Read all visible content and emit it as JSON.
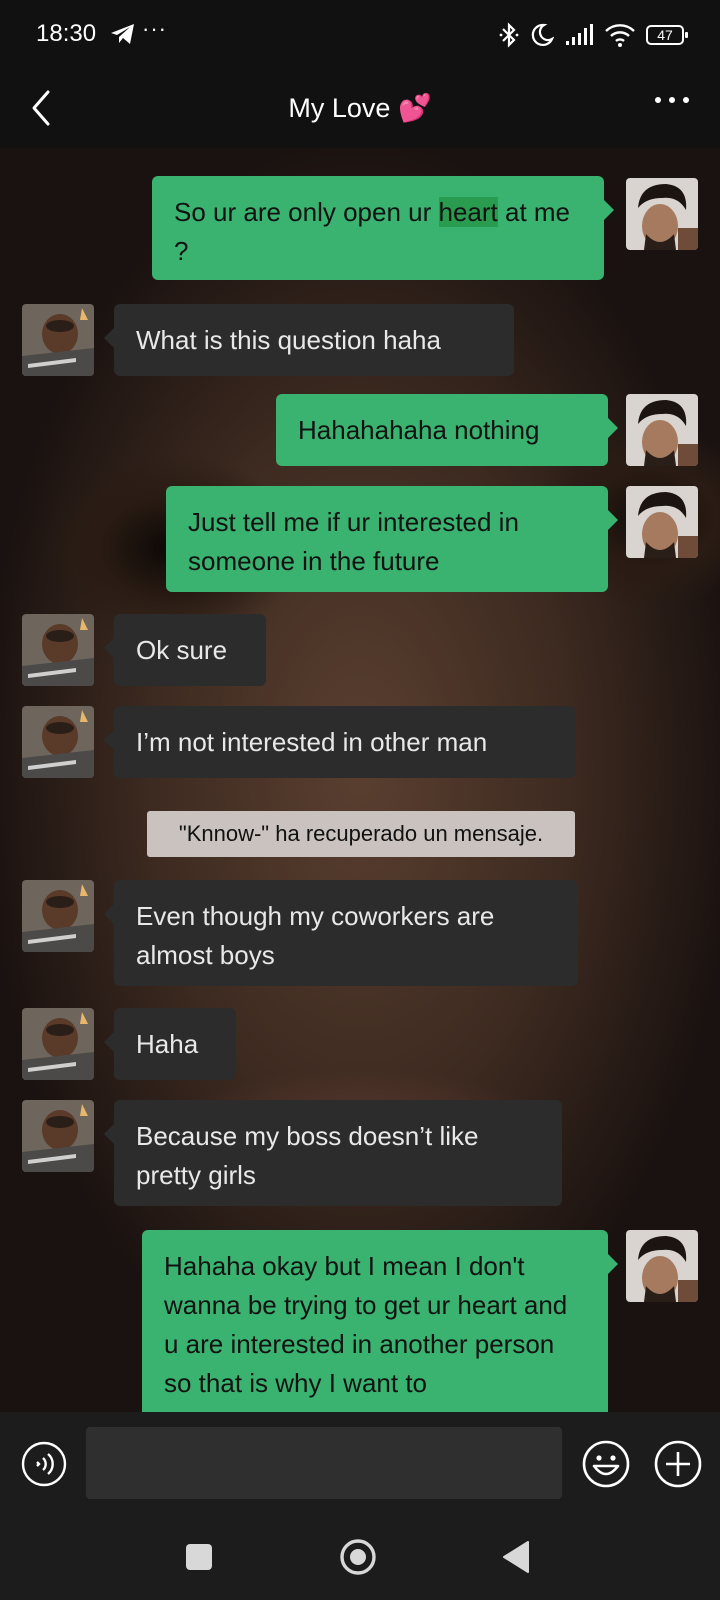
{
  "status_bar": {
    "time": "18:30",
    "battery": "47"
  },
  "header": {
    "title": "My Love 💕"
  },
  "messages": [
    {
      "side": "sent",
      "text_before": "So ur are only open ur ",
      "text_highlight": "heart",
      "text_after": " at me ?"
    },
    {
      "side": "recv",
      "text": "What is this question haha"
    },
    {
      "side": "sent",
      "text": "Hahahahaha nothing"
    },
    {
      "side": "sent",
      "text": "Just tell me if ur interested in someone in the future"
    },
    {
      "side": "recv",
      "text": "Ok sure"
    },
    {
      "side": "recv",
      "text": "I’m not interested in other man"
    },
    {
      "side": "recv",
      "text": "Even though my coworkers are almost boys"
    },
    {
      "side": "recv",
      "text": "Haha"
    },
    {
      "side": "recv",
      "text": "Because my boss doesn’t like pretty girls"
    },
    {
      "side": "sent",
      "text": "Hahaha okay but I mean I don't wanna be trying to get ur heart and u are interested in another person so that is why I want to"
    }
  ],
  "system_notice": "\"Knnow-\" ha recuperado un mensaje.",
  "input": {
    "value": "",
    "placeholder": ""
  },
  "icons": {
    "back": "chevron-left-icon",
    "more": "more-horizontal-icon",
    "voice": "voice-icon",
    "emoji": "smiley-icon",
    "plus": "plus-circle-icon"
  },
  "colors": {
    "sent_bubble": "#39b36f",
    "recv_bubble": "#2c2c2c",
    "background": "#111111"
  }
}
